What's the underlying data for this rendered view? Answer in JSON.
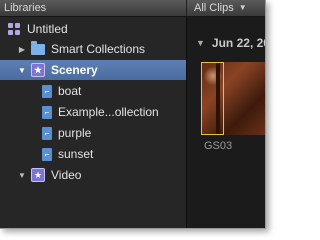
{
  "header": {
    "libraries_label": "Libraries",
    "filter_label": "All Clips"
  },
  "sidebar": {
    "items": [
      {
        "label": "Untitled",
        "type": "library",
        "expanded": true
      },
      {
        "label": "Smart Collections",
        "type": "folder",
        "expanded": false
      },
      {
        "label": "Scenery",
        "type": "event",
        "expanded": true,
        "selected": true
      },
      {
        "label": "boat",
        "type": "keyword-collection"
      },
      {
        "label": "Example...ollection",
        "type": "keyword-collection"
      },
      {
        "label": "purple",
        "type": "keyword-collection"
      },
      {
        "label": "sunset",
        "type": "keyword-collection"
      },
      {
        "label": "Video",
        "type": "event",
        "expanded": true
      }
    ]
  },
  "browser": {
    "date_label": "Jun 22, 20",
    "clips": [
      {
        "name": "GS03"
      }
    ]
  },
  "colors": {
    "selection": "#4b6ca1",
    "clip_highlight": "#e6c23a",
    "background": "#1d1d1d"
  }
}
